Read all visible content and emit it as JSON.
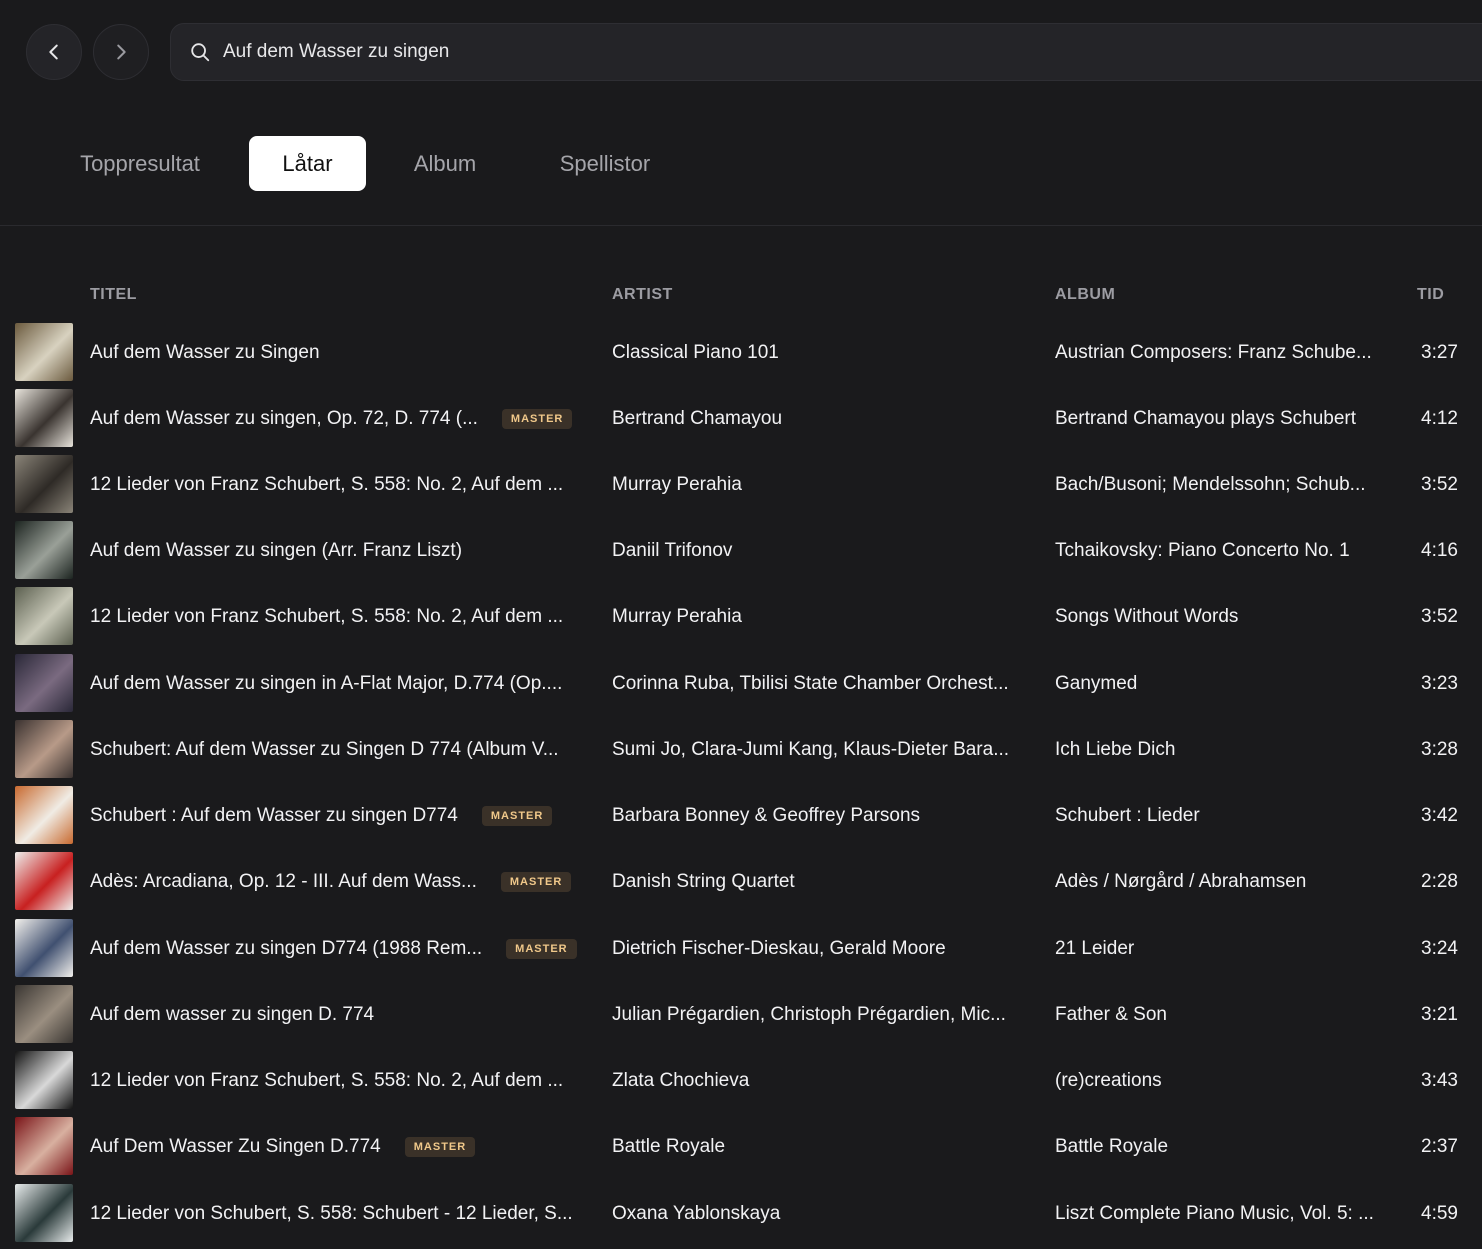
{
  "search": {
    "value": "Auf dem Wasser zu singen"
  },
  "tabs": [
    {
      "label": "Toppresultat",
      "active": false
    },
    {
      "label": "Låtar",
      "active": true
    },
    {
      "label": "Album",
      "active": false
    },
    {
      "label": "Spellistor",
      "active": false
    }
  ],
  "columns": {
    "title": "TITEL",
    "artist": "ARTIST",
    "album": "ALBUM",
    "time": "TID"
  },
  "rows": [
    {
      "title": "Auf dem Wasser zu Singen",
      "badge": "",
      "artist": "Classical Piano 101",
      "album": "Austrian Composers: Franz Schube...",
      "time": "3:27",
      "thumb": [
        "#6b5a3e",
        "#d8d2c0"
      ]
    },
    {
      "title": "Auf dem Wasser zu singen, Op. 72, D. 774 (...",
      "badge": "MASTER",
      "artist": "Bertrand Chamayou",
      "album": "Bertrand Chamayou plays Schubert",
      "time": "4:12",
      "thumb": [
        "#e8e4dc",
        "#3a3430"
      ]
    },
    {
      "title": "12 Lieder von Franz Schubert, S. 558: No. 2, Auf dem ...",
      "badge": "",
      "artist": "Murray Perahia",
      "album": "Bach/Busoni; Mendelssohn; Schub...",
      "time": "3:52",
      "thumb": [
        "#8a8478",
        "#2e2a26"
      ]
    },
    {
      "title": "Auf dem Wasser zu singen (Arr. Franz Liszt)",
      "badge": "",
      "artist": "Daniil Trifonov",
      "album": "Tchaikovsky: Piano Concerto No. 1",
      "time": "4:16",
      "thumb": [
        "#1c2420",
        "#9aa098"
      ]
    },
    {
      "title": "12 Lieder von Franz Schubert, S. 558: No. 2, Auf dem ...",
      "badge": "",
      "artist": "Murray Perahia",
      "album": "Songs Without Words",
      "time": "3:52",
      "thumb": [
        "#5c6050",
        "#c8c8b8"
      ]
    },
    {
      "title": "Auf dem Wasser zu singen in A-Flat Major, D.774 (Op....",
      "badge": "",
      "artist": "Corinna Ruba, Tbilisi State Chamber Orchest...",
      "album": "Ganymed",
      "time": "3:23",
      "thumb": [
        "#2a2838",
        "#7a6a80"
      ]
    },
    {
      "title": "Schubert: Auf dem Wasser zu Singen D 774 (Album V...",
      "badge": "",
      "artist": "Sumi Jo, Clara-Jumi Kang, Klaus-Dieter Bara...",
      "album": "Ich Liebe Dich",
      "time": "3:28",
      "thumb": [
        "#3a3230",
        "#b89a88"
      ]
    },
    {
      "title": "Schubert : Auf dem Wasser zu singen D774",
      "badge": "MASTER",
      "artist": "Barbara Bonney & Geoffrey Parsons",
      "album": "Schubert : Lieder",
      "time": "3:42",
      "thumb": [
        "#c86a30",
        "#f0ece4"
      ]
    },
    {
      "title": "Adès: Arcadiana, Op. 12 - III. Auf dem Wass...",
      "badge": "MASTER",
      "artist": "Danish String Quartet",
      "album": "Adès / Nørgård / Abrahamsen",
      "time": "2:28",
      "thumb": [
        "#eeeeec",
        "#c82020"
      ]
    },
    {
      "title": "Auf dem Wasser zu singen D774 (1988 Rem...",
      "badge": "MASTER",
      "artist": "Dietrich Fischer-Dieskau, Gerald Moore",
      "album": "21 Leider",
      "time": "3:24",
      "thumb": [
        "#f2f0ec",
        "#405070"
      ]
    },
    {
      "title": "Auf dem wasser zu singen D. 774",
      "badge": "",
      "artist": "Julian Prégardien, Christoph Prégardien, Mic...",
      "album": "Father & Son",
      "time": "3:21",
      "thumb": [
        "#3a3632",
        "#9a8e80"
      ]
    },
    {
      "title": "12 Lieder von Franz Schubert, S. 558: No. 2, Auf dem ...",
      "badge": "",
      "artist": "Zlata Chochieva",
      "album": "(re)creations",
      "time": "3:43",
      "thumb": [
        "#141414",
        "#d8d8d8"
      ]
    },
    {
      "title": "Auf Dem Wasser Zu Singen D.774",
      "badge": "MASTER",
      "artist": "Battle Royale",
      "album": "Battle Royale",
      "time": "2:37",
      "thumb": [
        "#7a1418",
        "#d8b0a0"
      ]
    },
    {
      "title": "12 Lieder von Schubert, S. 558: Schubert - 12 Lieder, S...",
      "badge": "",
      "artist": "Oxana Yablonskaya",
      "album": "Liszt Complete Piano Music, Vol. 5: ...",
      "time": "4:59",
      "thumb": [
        "#e8ecec",
        "#2a3a3a"
      ]
    }
  ]
}
